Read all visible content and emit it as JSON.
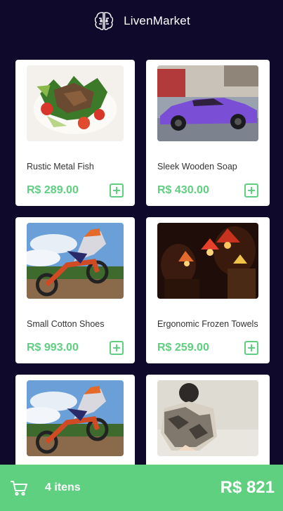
{
  "header": {
    "title": "LivenMarket",
    "logo_icon": "brain-icon"
  },
  "products": [
    {
      "name": "Rustic Metal Fish",
      "price": "R$ 289.00",
      "image": "salad-meat-photo"
    },
    {
      "name": "Sleek Wooden Soap",
      "price": "R$ 430.00",
      "image": "purple-sports-car-photo"
    },
    {
      "name": "Small Cotton Shoes",
      "price": "R$ 993.00",
      "image": "motocross-rider-photo"
    },
    {
      "name": "Ergonomic Frozen Towels",
      "price": "R$ 259.00",
      "image": "colorful-lamps-photo"
    },
    {
      "name": "",
      "price": "",
      "image": "motocross-rider-photo"
    },
    {
      "name": "",
      "price": "",
      "image": "woman-patterned-dress-photo"
    }
  ],
  "cart": {
    "count_label": "4 itens",
    "total": "R$ 821",
    "icon": "cart-icon"
  },
  "colors": {
    "background": "#0f0a2c",
    "accent": "#5fcf80",
    "card": "#ffffff"
  }
}
